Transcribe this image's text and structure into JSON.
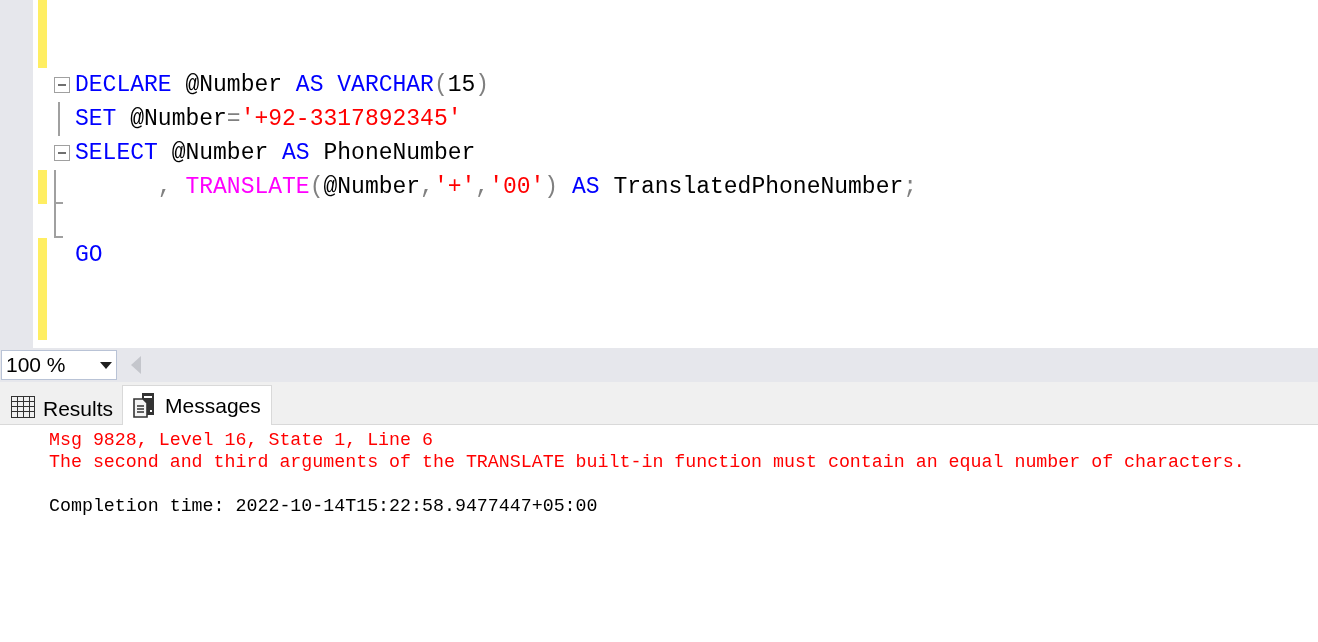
{
  "editor": {
    "lines": [
      {
        "changed": true
      },
      {
        "changed": true
      },
      {
        "changed": false,
        "kind": "fold-start",
        "tokens": [
          {
            "kind": "keyword",
            "text": "DECLARE"
          },
          {
            "kind": "plain",
            "text": " @Number "
          },
          {
            "kind": "keyword",
            "text": "AS"
          },
          {
            "kind": "keyword",
            "text": " VARCHAR"
          },
          {
            "kind": "operator",
            "text": "("
          },
          {
            "kind": "plain",
            "text": "15"
          },
          {
            "kind": "operator",
            "text": ")"
          }
        ]
      },
      {
        "changed": false,
        "kind": "fold-middle",
        "tokens": [
          {
            "kind": "keyword",
            "text": "SET"
          },
          {
            "kind": "plain",
            "text": " @Number"
          },
          {
            "kind": "operator",
            "text": "="
          },
          {
            "kind": "string",
            "text": "'+92-3317892345'"
          }
        ]
      },
      {
        "changed": false,
        "kind": "fold-start",
        "tokens": [
          {
            "kind": "keyword",
            "text": "SELECT"
          },
          {
            "kind": "plain",
            "text": " @Number "
          },
          {
            "kind": "keyword",
            "text": "AS"
          },
          {
            "kind": "plain",
            "text": " PhoneNumber"
          }
        ]
      },
      {
        "changed": true,
        "kind": "fold-end",
        "tokens": [
          {
            "kind": "operator",
            "text": "      ,"
          },
          {
            "kind": "function",
            "text": " TRANSLATE"
          },
          {
            "kind": "operator",
            "text": "("
          },
          {
            "kind": "plain",
            "text": "@Number"
          },
          {
            "kind": "operator",
            "text": ","
          },
          {
            "kind": "string",
            "text": "'+'"
          },
          {
            "kind": "operator",
            "text": ","
          },
          {
            "kind": "string",
            "text": "'00'"
          },
          {
            "kind": "operator",
            "text": ")"
          },
          {
            "kind": "keyword",
            "text": " AS"
          },
          {
            "kind": "plain",
            "text": " TranslatedPhoneNumber"
          },
          {
            "kind": "operator",
            "text": ";"
          }
        ]
      },
      {
        "changed": false,
        "kind": "fold-end"
      },
      {
        "changed": true,
        "tokens": [
          {
            "kind": "keyword",
            "text": "GO"
          }
        ]
      },
      {
        "changed": true
      },
      {
        "changed": true
      }
    ]
  },
  "zoom": {
    "value": "100 %"
  },
  "tabs": [
    {
      "label": "Results",
      "selected": false
    },
    {
      "label": "Messages",
      "selected": true
    }
  ],
  "messages": [
    {
      "kind": "error",
      "text": "Msg 9828, Level 16, State 1, Line 6"
    },
    {
      "kind": "error",
      "text": "The second and third arguments of the TRANSLATE built-in function must contain an equal number of characters."
    },
    {
      "kind": "info",
      "text": "Completion time: 2022-10-14T15:22:58.9477447+05:00"
    }
  ]
}
